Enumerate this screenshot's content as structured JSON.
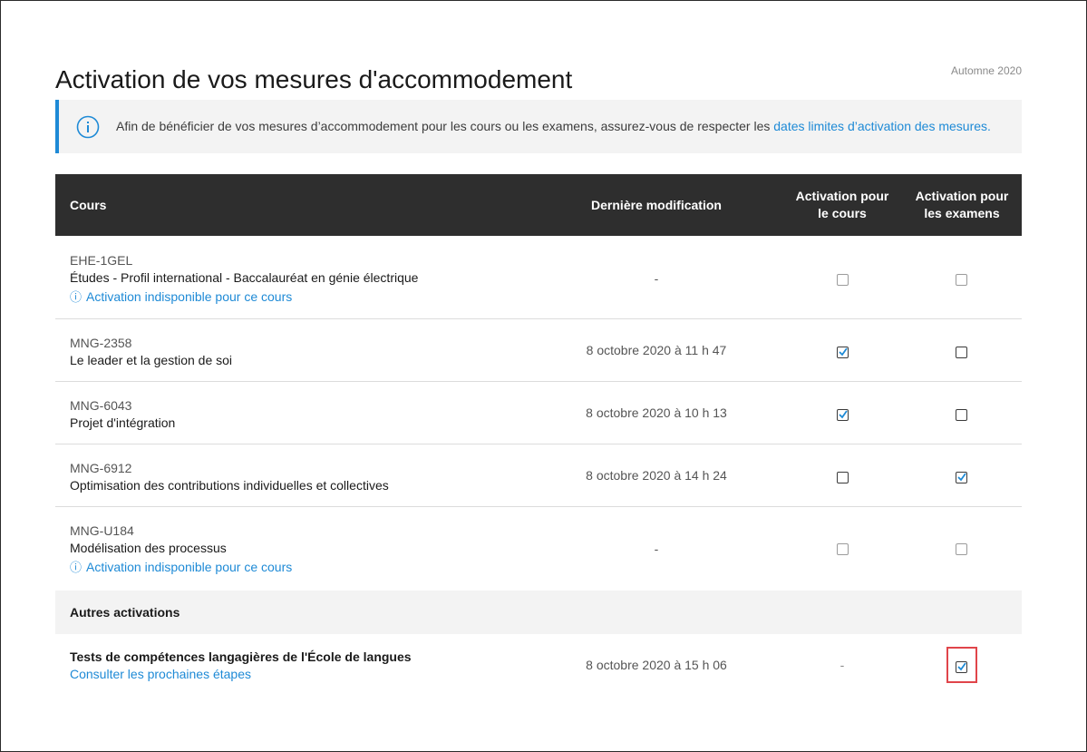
{
  "header": {
    "title": "Activation de vos mesures d'accommodement",
    "session": "Automne 2020"
  },
  "notice": {
    "icon": "info-icon",
    "text": "Afin de bénéficier de vos mesures d’accommodement pour les cours ou les examens, assurez-vous de respecter les ",
    "link": "dates limites d’activation des mesures."
  },
  "table": {
    "headers": {
      "course": "Cours",
      "modified": "Dernière modification",
      "activation_course_line1": "Activation pour",
      "activation_course_line2": "le cours",
      "activation_exam_line1": "Activation pour",
      "activation_exam_line2": "les examens"
    },
    "rows": [
      {
        "code": "EHE-1GEL",
        "name": "Études - Profil international - Baccalauréat en génie électrique",
        "warning": "Activation indisponible pour ce cours",
        "modified": "-",
        "course_checked": false,
        "exam_checked": false,
        "disabled": true
      },
      {
        "code": "MNG-2358",
        "name": "Le leader et la gestion de soi",
        "modified": "8 octobre 2020 à 11 h 47",
        "course_checked": true,
        "exam_checked": false,
        "disabled": false
      },
      {
        "code": "MNG-6043",
        "name": "Projet d'intégration",
        "modified": "8 octobre 2020 à 10 h 13",
        "course_checked": true,
        "exam_checked": false,
        "disabled": false
      },
      {
        "code": "MNG-6912",
        "name": "Optimisation des contributions individuelles et collectives",
        "modified": "8 octobre 2020 à 14 h 24",
        "course_checked": false,
        "exam_checked": true,
        "disabled": false
      },
      {
        "code": "MNG-U184",
        "name": "Modélisation des processus",
        "warning": "Activation indisponible pour ce cours",
        "modified": "-",
        "course_checked": false,
        "exam_checked": false,
        "disabled": true
      }
    ],
    "other_section_label": "Autres activations",
    "other_rows": [
      {
        "name": "Tests de compétences langagières de l'École de langues",
        "link": "Consulter les prochaines étapes",
        "modified": "8 octobre 2020 à 15 h 06",
        "course_value": "-",
        "exam_checked": true
      }
    ],
    "warning_icon": "ⓘ"
  },
  "colors": {
    "accent": "#1e8ad6",
    "header_bg": "#2e2e2e",
    "band_bg": "#f3f3f3",
    "highlight": "#e0454a"
  }
}
